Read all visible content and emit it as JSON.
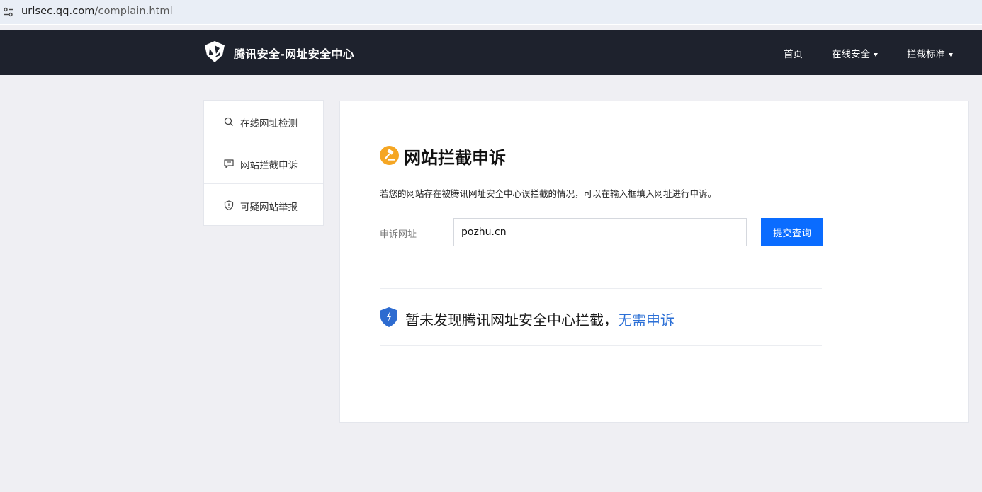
{
  "browser": {
    "url_host": "urlsec.qq.com",
    "url_path": "/complain.html"
  },
  "nav": {
    "brand": "腾讯安全-网址安全中心",
    "links": [
      {
        "label": "首页",
        "dropdown": false
      },
      {
        "label": "在线安全",
        "dropdown": true
      },
      {
        "label": "拦截标准",
        "dropdown": true
      }
    ]
  },
  "sidebar": {
    "items": [
      {
        "label": "在线网址检测",
        "icon": "search-icon"
      },
      {
        "label": "网站拦截申诉",
        "icon": "chat-icon"
      },
      {
        "label": "可疑网站举报",
        "icon": "shield-alert-icon"
      }
    ]
  },
  "main": {
    "title": "网站拦截申诉",
    "description": "若您的网站存在被腾讯网址安全中心误拦截的情况，可以在输入框填入网址进行申诉。",
    "field_label": "申诉网址",
    "input_value": "pozhu.cn",
    "submit_label": "提交查询",
    "result_text": "暂未发现腾讯网址安全中心拦截，",
    "result_link": "无需申诉"
  },
  "colors": {
    "nav_bg": "#1e222d",
    "accent_blue": "#0a6cff",
    "link_blue": "#2b6fd6",
    "title_icon": "#f5a623",
    "page_bg": "#efeff3"
  }
}
